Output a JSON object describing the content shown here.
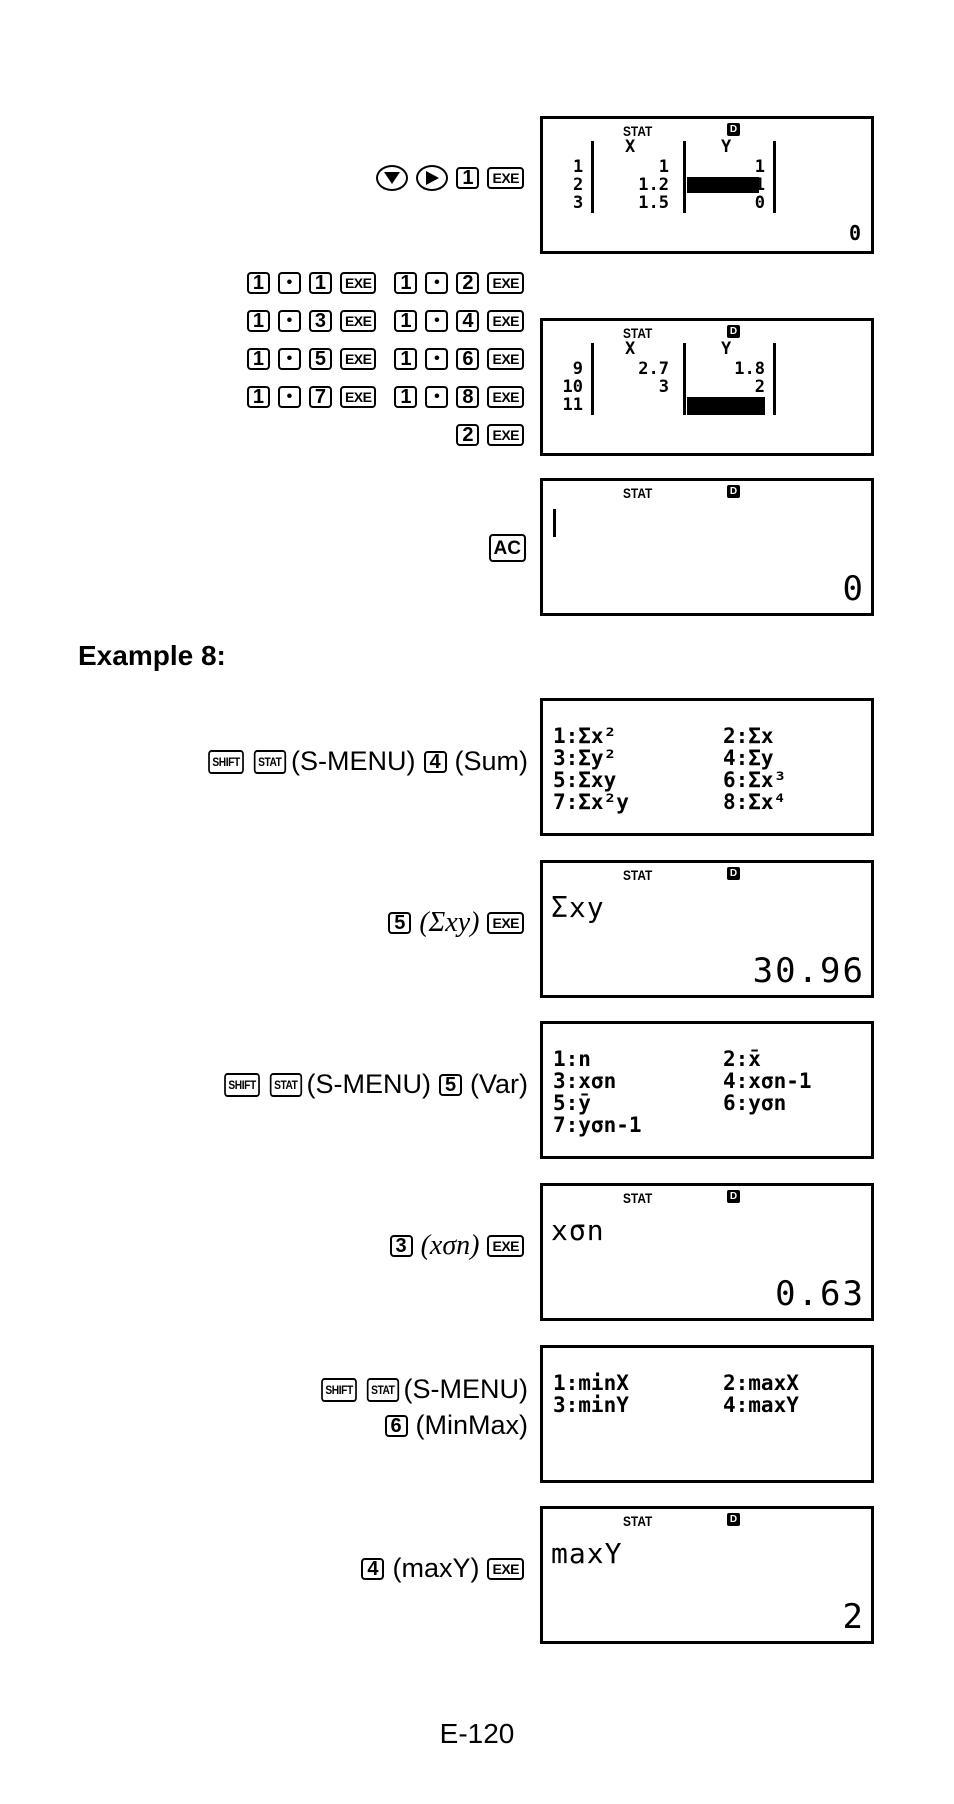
{
  "part1": {
    "step1": {
      "keys": [
        "down-arrow",
        "right-arrow",
        "1",
        "EXE"
      ],
      "screen": {
        "indicators": [
          "STAT",
          "D"
        ],
        "headers": [
          "X",
          "Y"
        ],
        "rows": [
          {
            "n": "1",
            "x": "1",
            "y": "1"
          },
          {
            "n": "2",
            "x": "1.2",
            "y": "1"
          },
          {
            "n": "3",
            "x": "1.5",
            "y": "0"
          }
        ],
        "result": "0"
      }
    },
    "step2": {
      "key_rows": [
        [
          "1",
          "•",
          "1",
          "EXE",
          "1",
          "•",
          "2",
          "EXE"
        ],
        [
          "1",
          "•",
          "3",
          "EXE",
          "1",
          "•",
          "4",
          "EXE"
        ],
        [
          "1",
          "•",
          "5",
          "EXE",
          "1",
          "•",
          "6",
          "EXE"
        ],
        [
          "1",
          "•",
          "7",
          "EXE",
          "1",
          "•",
          "8",
          "EXE"
        ],
        [
          "2",
          "EXE"
        ]
      ],
      "screen": {
        "indicators": [
          "STAT",
          "D"
        ],
        "headers": [
          "X",
          "Y"
        ],
        "rows": [
          {
            "n": "9",
            "x": "2.7",
            "y": "1.8"
          },
          {
            "n": "10",
            "x": "3",
            "y": "2"
          },
          {
            "n": "11",
            "x": "",
            "y": ""
          }
        ]
      }
    },
    "step3": {
      "keys": [
        "AC"
      ],
      "screen": {
        "indicators": [
          "STAT",
          "D"
        ],
        "result": "0"
      }
    }
  },
  "example_title": "Example 8:",
  "example8": [
    {
      "keys": [
        "SHIFT",
        "STAT",
        "(S-MENU)",
        "4",
        "(Sum)"
      ],
      "menu": [
        "1:Σx²",
        "2:Σx",
        "3:Σy²",
        "4:Σy",
        "5:Σxy",
        "6:Σx³",
        "7:Σx²y",
        "8:Σx⁴"
      ]
    },
    {
      "keys": [
        "5",
        "(Σxy)",
        "EXE"
      ],
      "screen": {
        "indicators": [
          "STAT",
          "D"
        ],
        "input": "Σxy",
        "result": "30.96"
      }
    },
    {
      "keys": [
        "SHIFT",
        "STAT",
        "(S-MENU)",
        "5",
        "(Var)"
      ],
      "menu": [
        "1:n",
        "2:x̄",
        "3:xσn",
        "4:xσn-1",
        "5:ȳ",
        "6:yσn",
        "7:yσn-1"
      ]
    },
    {
      "keys": [
        "3",
        "(xσn)",
        "EXE"
      ],
      "screen": {
        "indicators": [
          "STAT",
          "D"
        ],
        "input": "xσn",
        "result": "0.63"
      }
    },
    {
      "keys_line1": [
        "SHIFT",
        "STAT",
        "(S-MENU)"
      ],
      "keys_line2": [
        "6",
        "(MinMax)"
      ],
      "menu": [
        "1:minX",
        "2:maxX",
        "3:minY",
        "4:maxY"
      ]
    },
    {
      "keys": [
        "4",
        "(maxY)",
        "EXE"
      ],
      "screen": {
        "indicators": [
          "STAT",
          "D"
        ],
        "input": "maxY",
        "result": "2"
      }
    }
  ],
  "page_number": "E-120"
}
